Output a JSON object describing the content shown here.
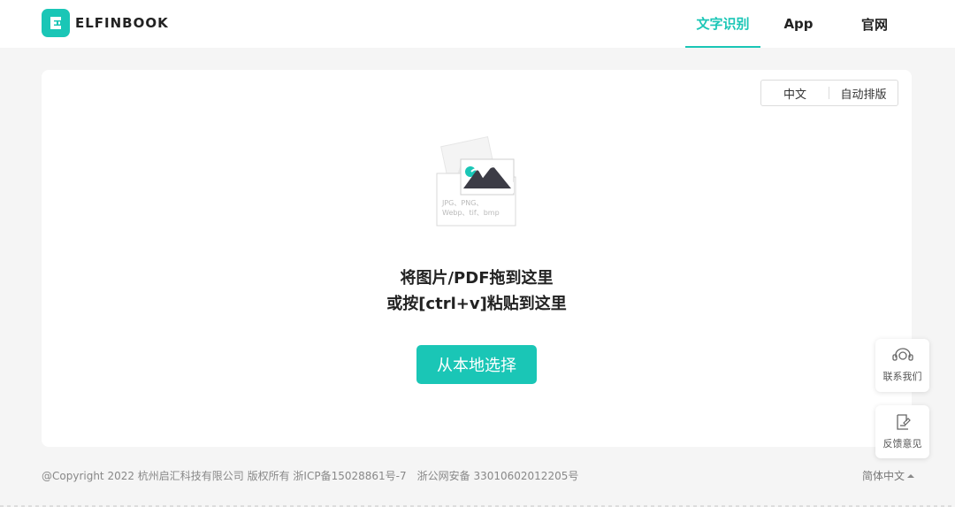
{
  "header": {
    "logo_text": "ELFINBOOK",
    "nav": [
      {
        "label": "文字识别",
        "active": true
      },
      {
        "label": "App",
        "active": false
      },
      {
        "label": "官网",
        "active": false
      }
    ]
  },
  "main": {
    "options": {
      "language": "中文",
      "layout": "自动排版"
    },
    "upload_formats_line1": "JPG、PNG、",
    "upload_formats_line2": "Webp、tif、bmp",
    "drop_line1": "将图片/PDF拖到这里",
    "drop_line2": "或按[ctrl+v]粘贴到这里",
    "choose_button": "从本地选择"
  },
  "float": {
    "contact": "联系我们",
    "feedback": "反馈意见"
  },
  "footer": {
    "copyright": "@Copyright 2022 杭州启汇科技有限公司 版权所有 浙ICP备15028861号-7",
    "police": "浙公网安备 33010602012205号",
    "language": "简体中文"
  },
  "colors": {
    "accent": "#1ac6b6",
    "page_bg": "#f5f5f5",
    "card_bg": "#ffffff"
  },
  "icons": {
    "logo": "logo-e-icon",
    "upload": "image-upload-icon",
    "contact": "headset-icon",
    "feedback": "edit-icon",
    "police": "police-badge-icon",
    "lang_caret": "caret-up-icon"
  }
}
